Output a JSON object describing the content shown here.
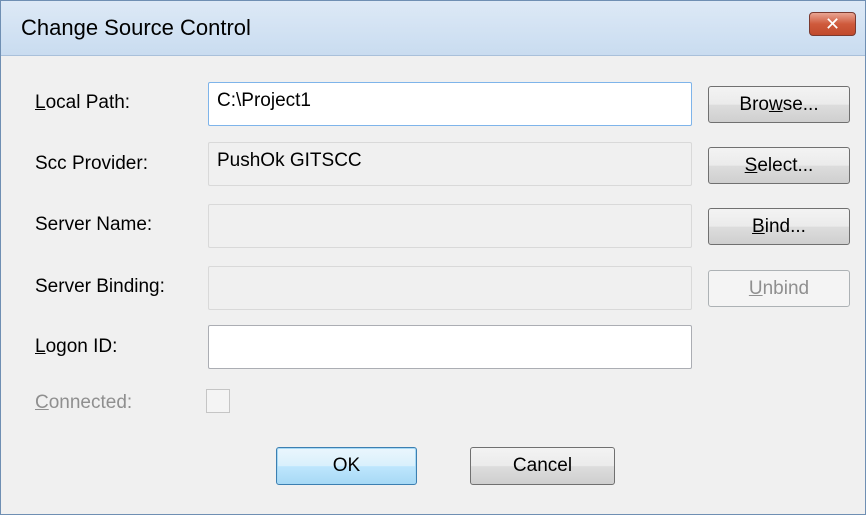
{
  "window": {
    "title": "Change Source Control",
    "close_label": "✕"
  },
  "form": {
    "local_path": {
      "label_mnemonic": "L",
      "label_rest": "ocal Path:",
      "value": "C:\\Project1"
    },
    "scc_provider": {
      "label": "Scc Provider:",
      "value": "PushOk GITSCC"
    },
    "server_name": {
      "label": "Server Name:",
      "value": ""
    },
    "server_binding": {
      "label": "Server Binding:",
      "value": ""
    },
    "logon_id": {
      "label_mnemonic": "L",
      "label_rest": "ogon ID:",
      "value": ""
    },
    "connected": {
      "label_mnemonic": "C",
      "label_rest": "onnected:",
      "checked": false
    }
  },
  "buttons": {
    "browse": {
      "pre": "Bro",
      "mnemonic": "w",
      "post": "se..."
    },
    "select": {
      "pre": "",
      "mnemonic": "S",
      "post": "elect..."
    },
    "bind": {
      "pre": "",
      "mnemonic": "B",
      "post": "ind..."
    },
    "unbind": {
      "pre": "",
      "mnemonic": "U",
      "post": "nbind"
    },
    "ok": "OK",
    "cancel": "Cancel"
  }
}
